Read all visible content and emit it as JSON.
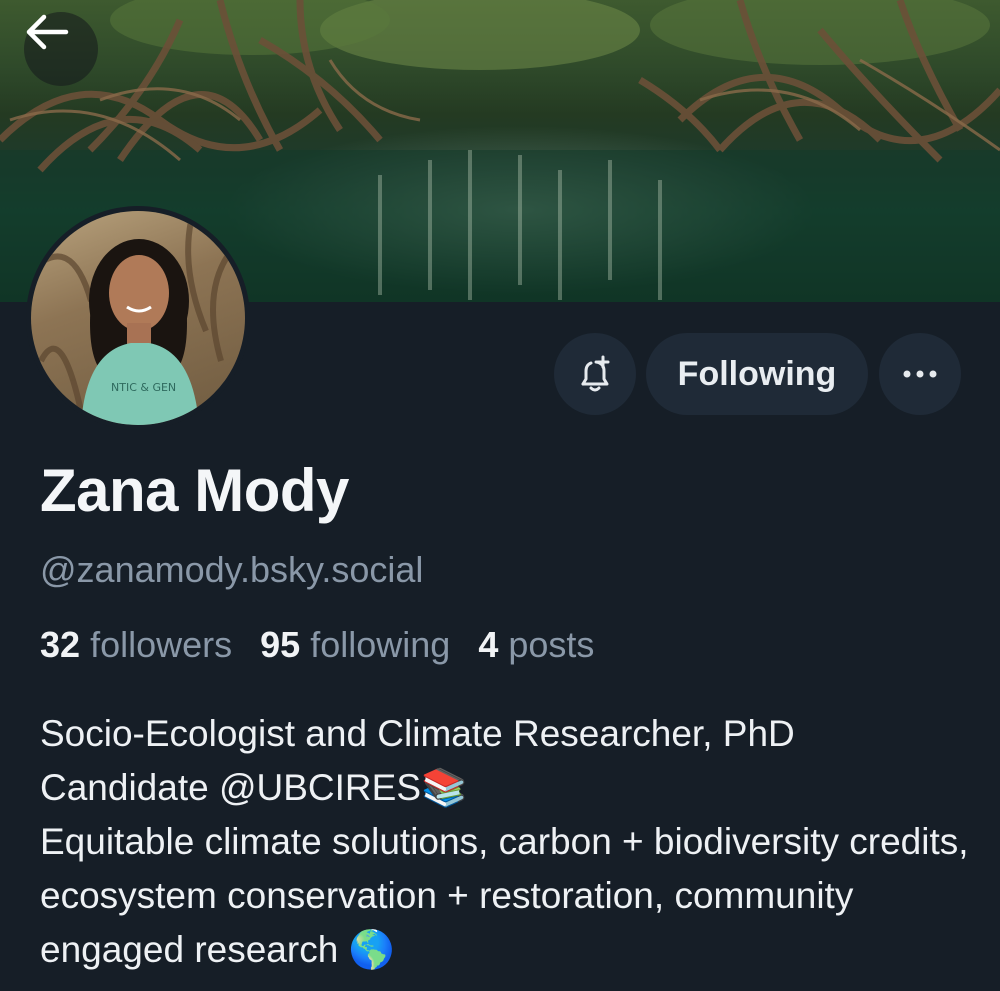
{
  "profile": {
    "display_name": "Zana Mody",
    "handle": "@zanamody.bsky.social",
    "stats": {
      "followers_count": "32",
      "followers_label": "followers",
      "following_count": "95",
      "following_label": "following",
      "posts_count": "4",
      "posts_label": "posts"
    },
    "bio": {
      "line1": "Socio-Ecologist and Climate Researcher, PhD Candidate @UBCIRES📚",
      "line2": "Equitable climate solutions, carbon + biodiversity credits, ecosystem conservation + restoration, community engaged research 🌎"
    }
  },
  "actions": {
    "following_label": "Following",
    "more_label": "•••"
  },
  "icons": {
    "back": "arrow-left-icon",
    "notify": "bell-plus-icon",
    "more": "ellipsis-icon"
  },
  "colors": {
    "background": "#161e27",
    "button_bg": "#1f2a37",
    "muted_text": "#8a98a8"
  }
}
